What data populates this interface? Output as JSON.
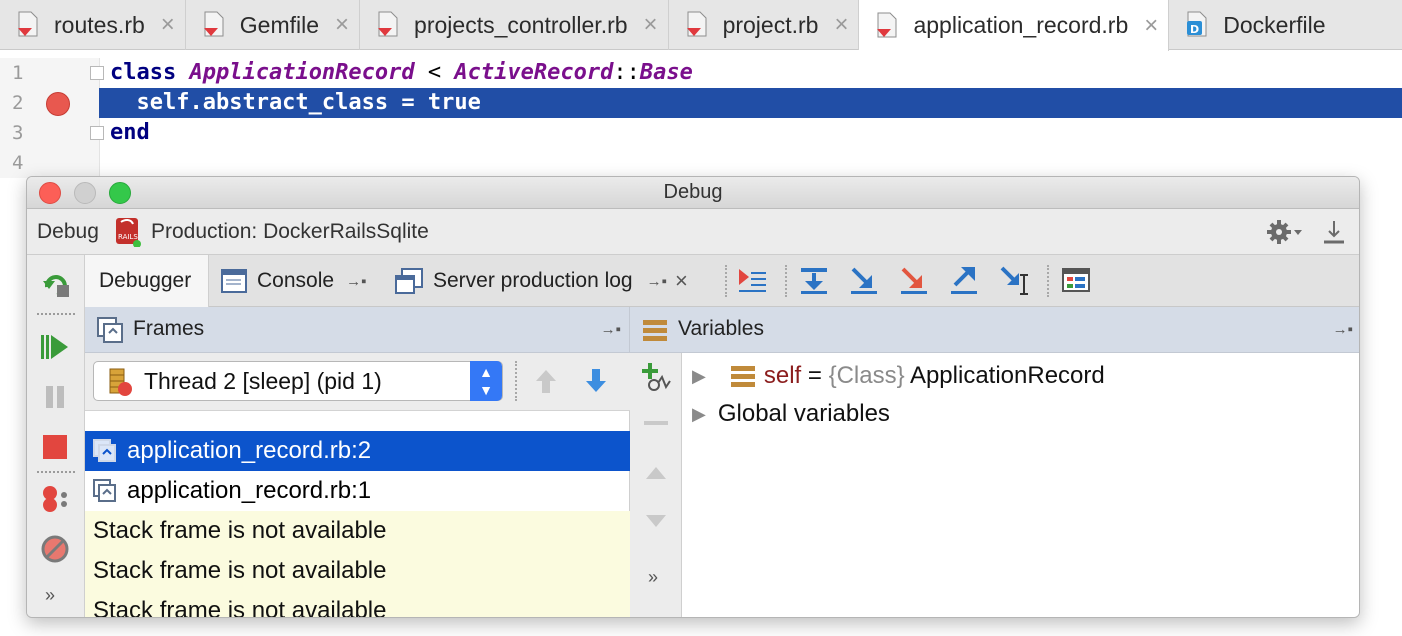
{
  "editor_tabs": [
    {
      "label": "routes.rb",
      "active": false,
      "icon": "ruby-file-icon"
    },
    {
      "label": "Gemfile",
      "active": false,
      "icon": "ruby-file-icon"
    },
    {
      "label": "projects_controller.rb",
      "active": false,
      "icon": "ruby-file-icon"
    },
    {
      "label": "project.rb",
      "active": false,
      "icon": "ruby-file-icon"
    },
    {
      "label": "application_record.rb",
      "active": true,
      "icon": "ruby-file-icon"
    },
    {
      "label": "Dockerfile",
      "active": false,
      "icon": "docker-file-icon"
    }
  ],
  "tab_close_glyph": "×",
  "editor": {
    "line_numbers": [
      "1",
      "2",
      "3",
      "4"
    ],
    "line1": {
      "kw": "class",
      "name": "ApplicationRecord",
      "op": " < ",
      "parent": "ActiveRecord",
      "sep": "::",
      "parent2": "Base"
    },
    "line2": {
      "text": "  self.abstract_class = ",
      "kw": "true"
    },
    "line3": {
      "kw": "end"
    },
    "breakpoint_line": "2"
  },
  "debug": {
    "window_title": "Debug",
    "header_label": "Debug",
    "run_config": "Production: DockerRailsSqlite",
    "tabs": {
      "debugger": "Debugger",
      "console": "Console",
      "server_log": "Server production log"
    },
    "frames_title": "Frames",
    "variables_title": "Variables",
    "thread": "Thread 2 [sleep] (pid 1)",
    "frames": [
      {
        "label": "application_record.rb:2",
        "selected": true
      },
      {
        "label": "application_record.rb:1",
        "selected": false
      }
    ],
    "unavailable": [
      "Stack frame is not available",
      "Stack frame is not available",
      "Stack frame is not available"
    ],
    "variables": {
      "self_name": "self",
      "self_eq": " = ",
      "self_type": "{Class}",
      "self_value": " ApplicationRecord",
      "global": "Global variables"
    },
    "more_glyph": "»"
  },
  "colors": {
    "selection": "#0c54cc",
    "line_highlight": "#214ea6",
    "breakpoint": "#e8584f",
    "keyword": "#000080",
    "class_name": "#7a0f8c"
  }
}
